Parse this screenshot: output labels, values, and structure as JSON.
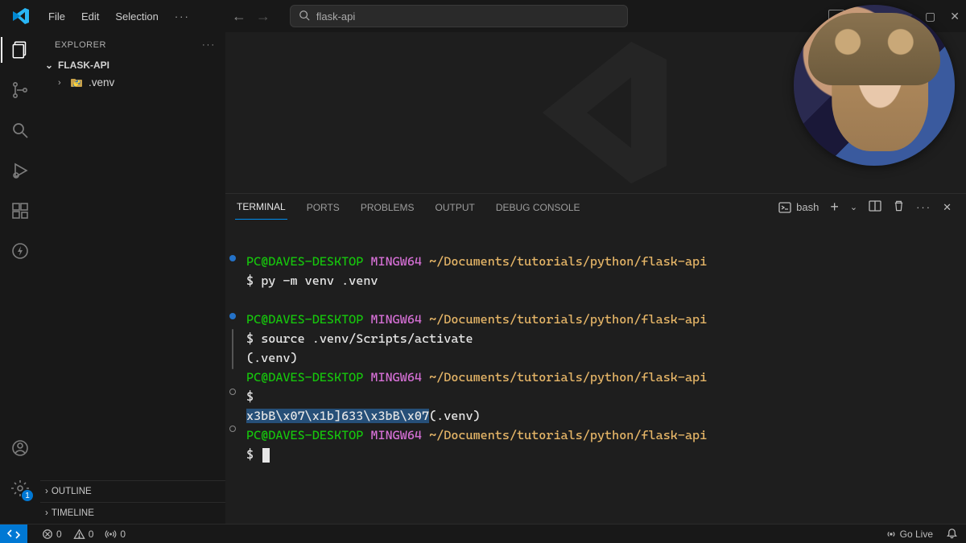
{
  "menu": {
    "file": "File",
    "edit": "Edit",
    "selection": "Selection"
  },
  "search": {
    "placeholder": "flask-api"
  },
  "explorer": {
    "title": "EXPLORER",
    "root": "FLASK-API",
    "items": [
      {
        "name": ".venv"
      }
    ],
    "sections": {
      "outline": "OUTLINE",
      "timeline": "TIMELINE"
    }
  },
  "activity": {
    "settings_badge": "1"
  },
  "panel": {
    "tabs": {
      "terminal": "TERMINAL",
      "ports": "PORTS",
      "problems": "PROBLEMS",
      "output": "OUTPUT",
      "debug": "DEBUG CONSOLE"
    },
    "shell": "bash"
  },
  "terminal": {
    "prompt": {
      "userhost": "PC@DAVES-DESKTOP",
      "shell": "MINGW64",
      "cwd": "~/Documents/tutorials/python/flask-api",
      "symbol": "$"
    },
    "cmd1": "py -m venv .venv",
    "cmd2": "source .venv/Scripts/activate",
    "venv": "(.venv)",
    "escape_seq": "x3bB\\x07\\x1b]633\\x3bB\\x07",
    "escape_suffix": "(.venv)"
  },
  "status": {
    "errors": "0",
    "warnings": "0",
    "ports": "0",
    "golive": "Go Live"
  },
  "colors": {
    "accent": "#0078d4"
  }
}
